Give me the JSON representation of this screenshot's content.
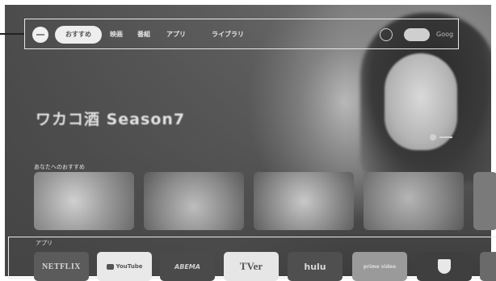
{
  "nav": {
    "active_tab": "おすすめ",
    "tabs": [
      "映画",
      "番組",
      "アプリ",
      "ライブラリ"
    ],
    "right_text": "Goog"
  },
  "hero": {
    "small_text": "",
    "title": "ワカコ酒 Season7",
    "subtitle": ""
  },
  "recommendations": {
    "label": "あなたへのおすすめ"
  },
  "apps": {
    "label": "アプリ",
    "items": [
      "NETFLIX",
      "YouTube",
      "ABEMA",
      "TVer",
      "hulu",
      "prime video"
    ]
  }
}
